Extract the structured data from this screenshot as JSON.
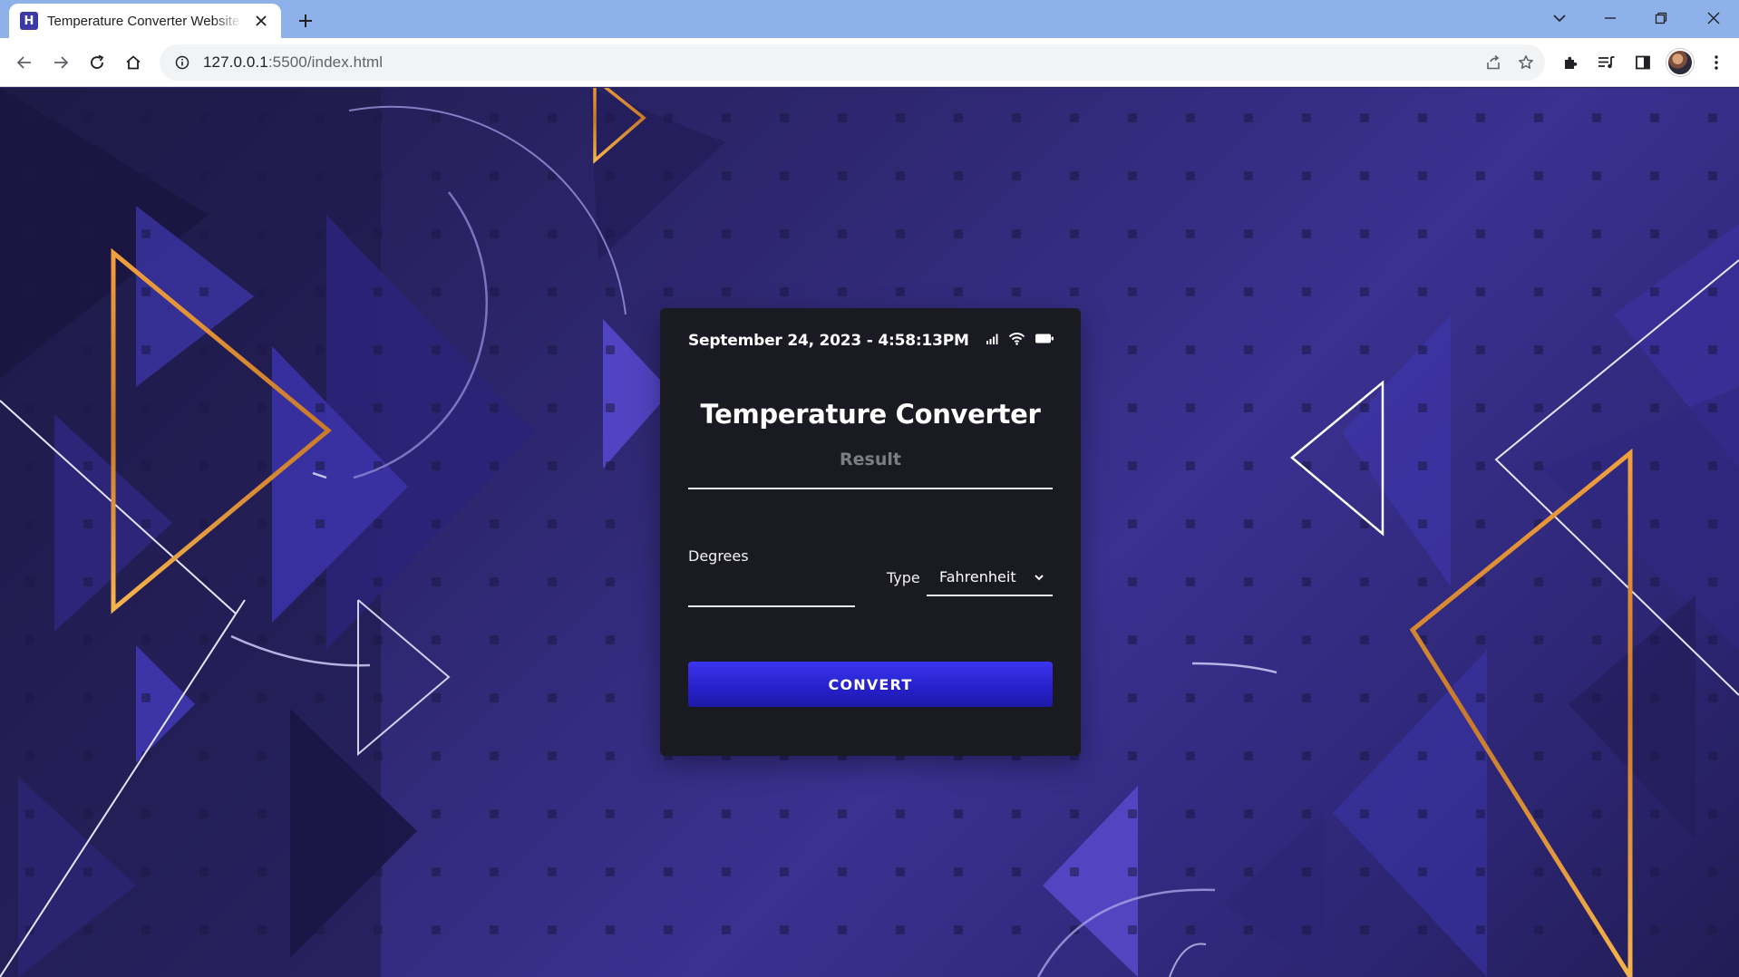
{
  "browser": {
    "tab_title": "Temperature Converter Website",
    "tab_favicon": "H",
    "new_tab_symbol": "+",
    "url_host": "127.0.0.1",
    "url_path": ":5500/index.html",
    "close_symbol": "✕"
  },
  "app": {
    "datetime": "September 24, 2023 - 4:58:13PM",
    "title": "Temperature Converter",
    "result_label": "Result",
    "degrees_label": "Degrees",
    "degrees_value": "",
    "type_label": "Type",
    "type_selected": "Fahrenheit",
    "convert_label": "CONVERT"
  },
  "icons": {
    "status": [
      "signal-icon",
      "wifi-icon",
      "battery-icon"
    ]
  },
  "colors": {
    "accent_button": "#2520c9",
    "card_bg": "#1a1a22",
    "page_bg": "#2e2770",
    "gold_outline": "#e89a3c",
    "titlebar": "#8fb1ea"
  }
}
